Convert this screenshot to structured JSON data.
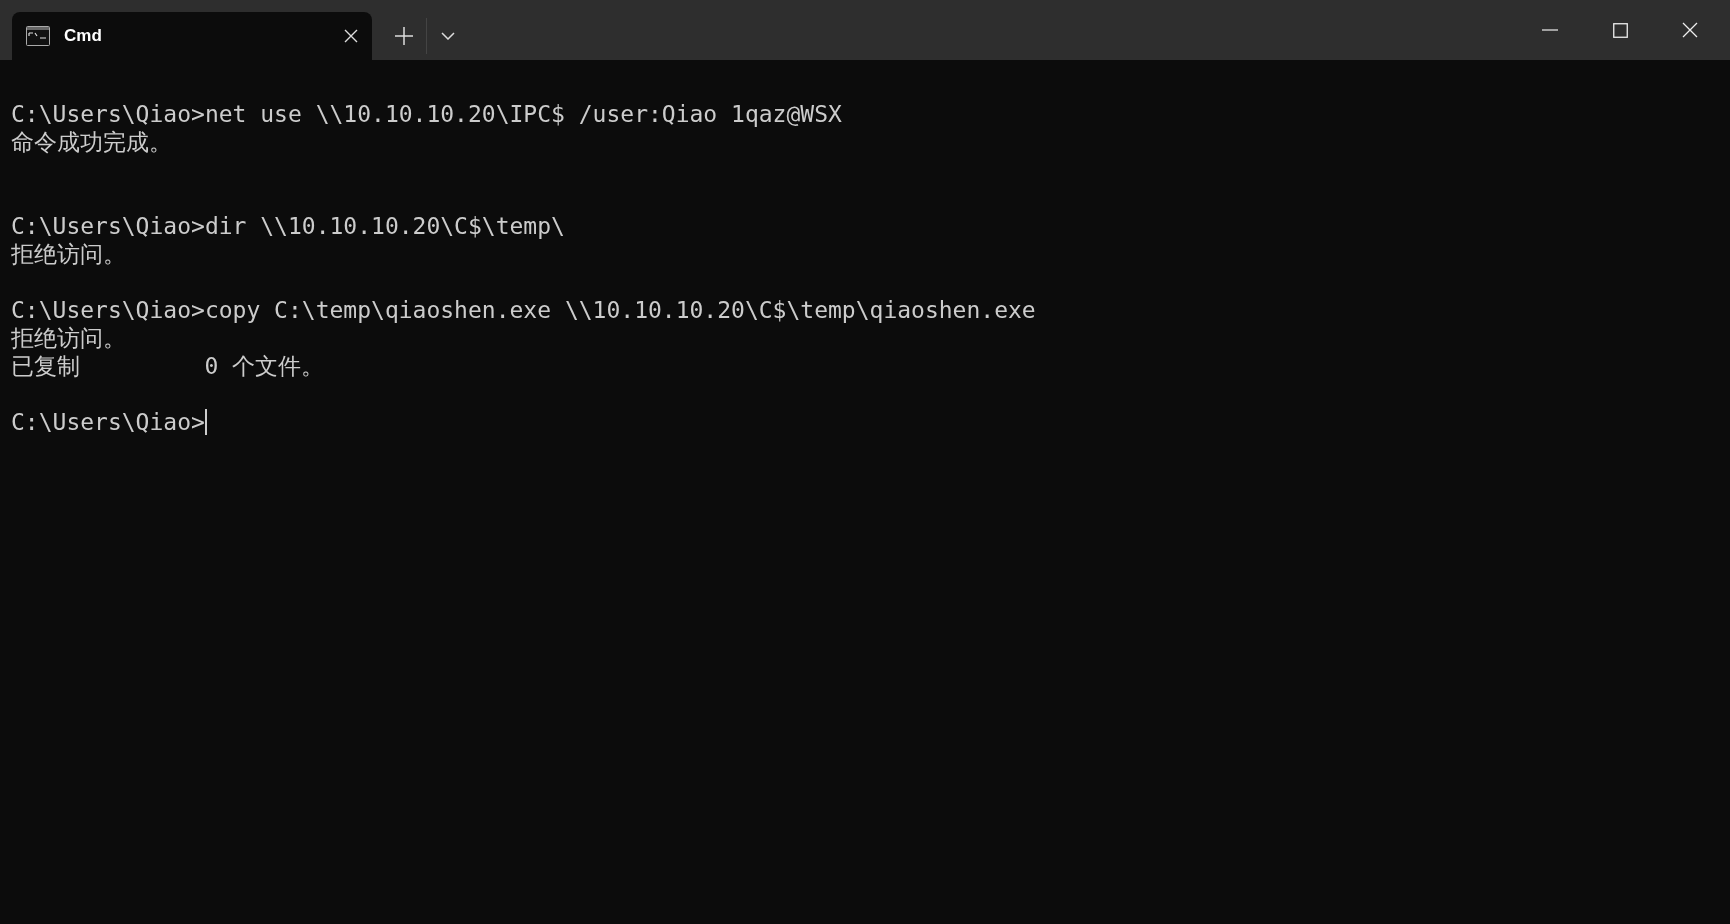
{
  "tabs": [
    {
      "title": "Cmd",
      "selected": true
    }
  ],
  "lines": [
    {
      "kind": "prompt",
      "prompt": "C:\\Users\\Qiao>",
      "command": "net use \\\\10.10.10.20\\IPC$ /user:Qiao 1qaz@WSX"
    },
    {
      "kind": "output",
      "text": "命令成功完成。"
    },
    {
      "kind": "blank"
    },
    {
      "kind": "blank"
    },
    {
      "kind": "prompt",
      "prompt": "C:\\Users\\Qiao>",
      "command": "dir \\\\10.10.10.20\\C$\\temp\\"
    },
    {
      "kind": "output",
      "text": "拒绝访问。"
    },
    {
      "kind": "blank"
    },
    {
      "kind": "prompt",
      "prompt": "C:\\Users\\Qiao>",
      "command": "copy C:\\temp\\qiaoshen.exe \\\\10.10.10.20\\C$\\temp\\qiaoshen.exe"
    },
    {
      "kind": "output",
      "text": "拒绝访问。"
    },
    {
      "kind": "output",
      "text": "已复制         0 个文件。"
    },
    {
      "kind": "blank"
    },
    {
      "kind": "prompt",
      "prompt": "C:\\Users\\Qiao>",
      "cursor": true
    }
  ]
}
